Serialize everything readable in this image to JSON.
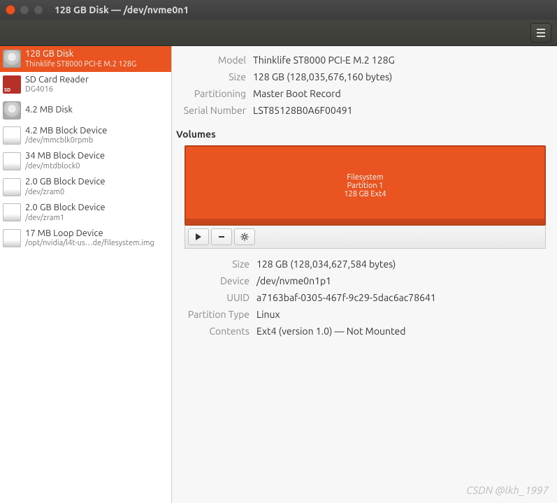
{
  "window": {
    "title": "128 GB Disk — /dev/nvme0n1"
  },
  "sidebar": {
    "items": [
      {
        "title": "128 GB Disk",
        "sub": "Thinklife ST8000 PCI-E M.2 128G",
        "icon": "disk",
        "selected": true
      },
      {
        "title": "SD Card Reader",
        "sub": "DG4016",
        "icon": "sd",
        "selected": false
      },
      {
        "title": "4.2 MB Disk",
        "sub": "",
        "icon": "disk",
        "selected": false
      },
      {
        "title": "4.2 MB Block Device",
        "sub": "/dev/mmcblk0rpmb",
        "icon": "blk",
        "selected": false
      },
      {
        "title": "34 MB Block Device",
        "sub": "/dev/mtdblock0",
        "icon": "blk",
        "selected": false
      },
      {
        "title": "2.0 GB Block Device",
        "sub": "/dev/zram0",
        "icon": "blk",
        "selected": false
      },
      {
        "title": "2.0 GB Block Device",
        "sub": "/dev/zram1",
        "icon": "blk",
        "selected": false
      },
      {
        "title": "17 MB Loop Device",
        "sub": "/opt/nvidia/l4t-us…de/filesystem.img",
        "icon": "loop",
        "selected": false
      }
    ]
  },
  "info": {
    "labels": {
      "model": "Model",
      "size": "Size",
      "partitioning": "Partitioning",
      "serial": "Serial Number"
    },
    "model": "Thinklife ST8000 PCI-E M.2 128G",
    "size": "128 GB (128,035,676,160 bytes)",
    "partitioning": "Master Boot Record",
    "serial": "LST85128B0A6F00491"
  },
  "volumes": {
    "header": "Volumes",
    "partition": {
      "line1": "Filesystem",
      "line2": "Partition 1",
      "line3": "128 GB Ext4"
    }
  },
  "details": {
    "labels": {
      "size": "Size",
      "device": "Device",
      "uuid": "UUID",
      "ptype": "Partition Type",
      "contents": "Contents"
    },
    "size": "128 GB (128,034,627,584 bytes)",
    "device": "/dev/nvme0n1p1",
    "uuid": "a7163baf-0305-467f-9c29-5dac6ac78641",
    "ptype": "Linux",
    "contents": "Ext4 (version 1.0) — Not Mounted"
  },
  "watermark": "CSDN @lkh_1997"
}
